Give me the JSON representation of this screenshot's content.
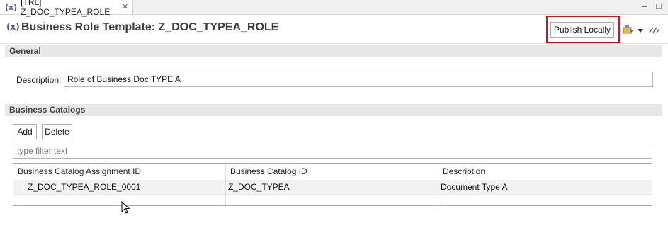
{
  "tab": {
    "icon_text": "(x)",
    "title": "[TRL] Z_DOC_TYPEA_ROLE",
    "close_glyph": "✕"
  },
  "window_controls": {
    "minimize": "–",
    "maximize": "□"
  },
  "header": {
    "icon_text": "(x)",
    "title": "Business Role Template: Z_DOC_TYPEA_ROLE",
    "publish_label": "Publish Locally"
  },
  "general": {
    "heading": "General",
    "description_label": "Description:",
    "description_value": "Role of Business Doc TYPE A"
  },
  "catalogs": {
    "heading": "Business Catalogs",
    "add_label": "Add",
    "delete_label": "Delete",
    "filter_placeholder": "type filter text",
    "columns": [
      "Business Catalog Assignment ID",
      "Business Catalog ID",
      "Description"
    ],
    "rows": [
      [
        "Z_DOC_TYPEA_ROLE_0001",
        "Z_DOC_TYPEA",
        "Document Type A"
      ]
    ]
  },
  "colors": {
    "highlight": "#d8101c",
    "icon_purple": "#6a4da0",
    "section_bg": "#e8e8e8"
  }
}
